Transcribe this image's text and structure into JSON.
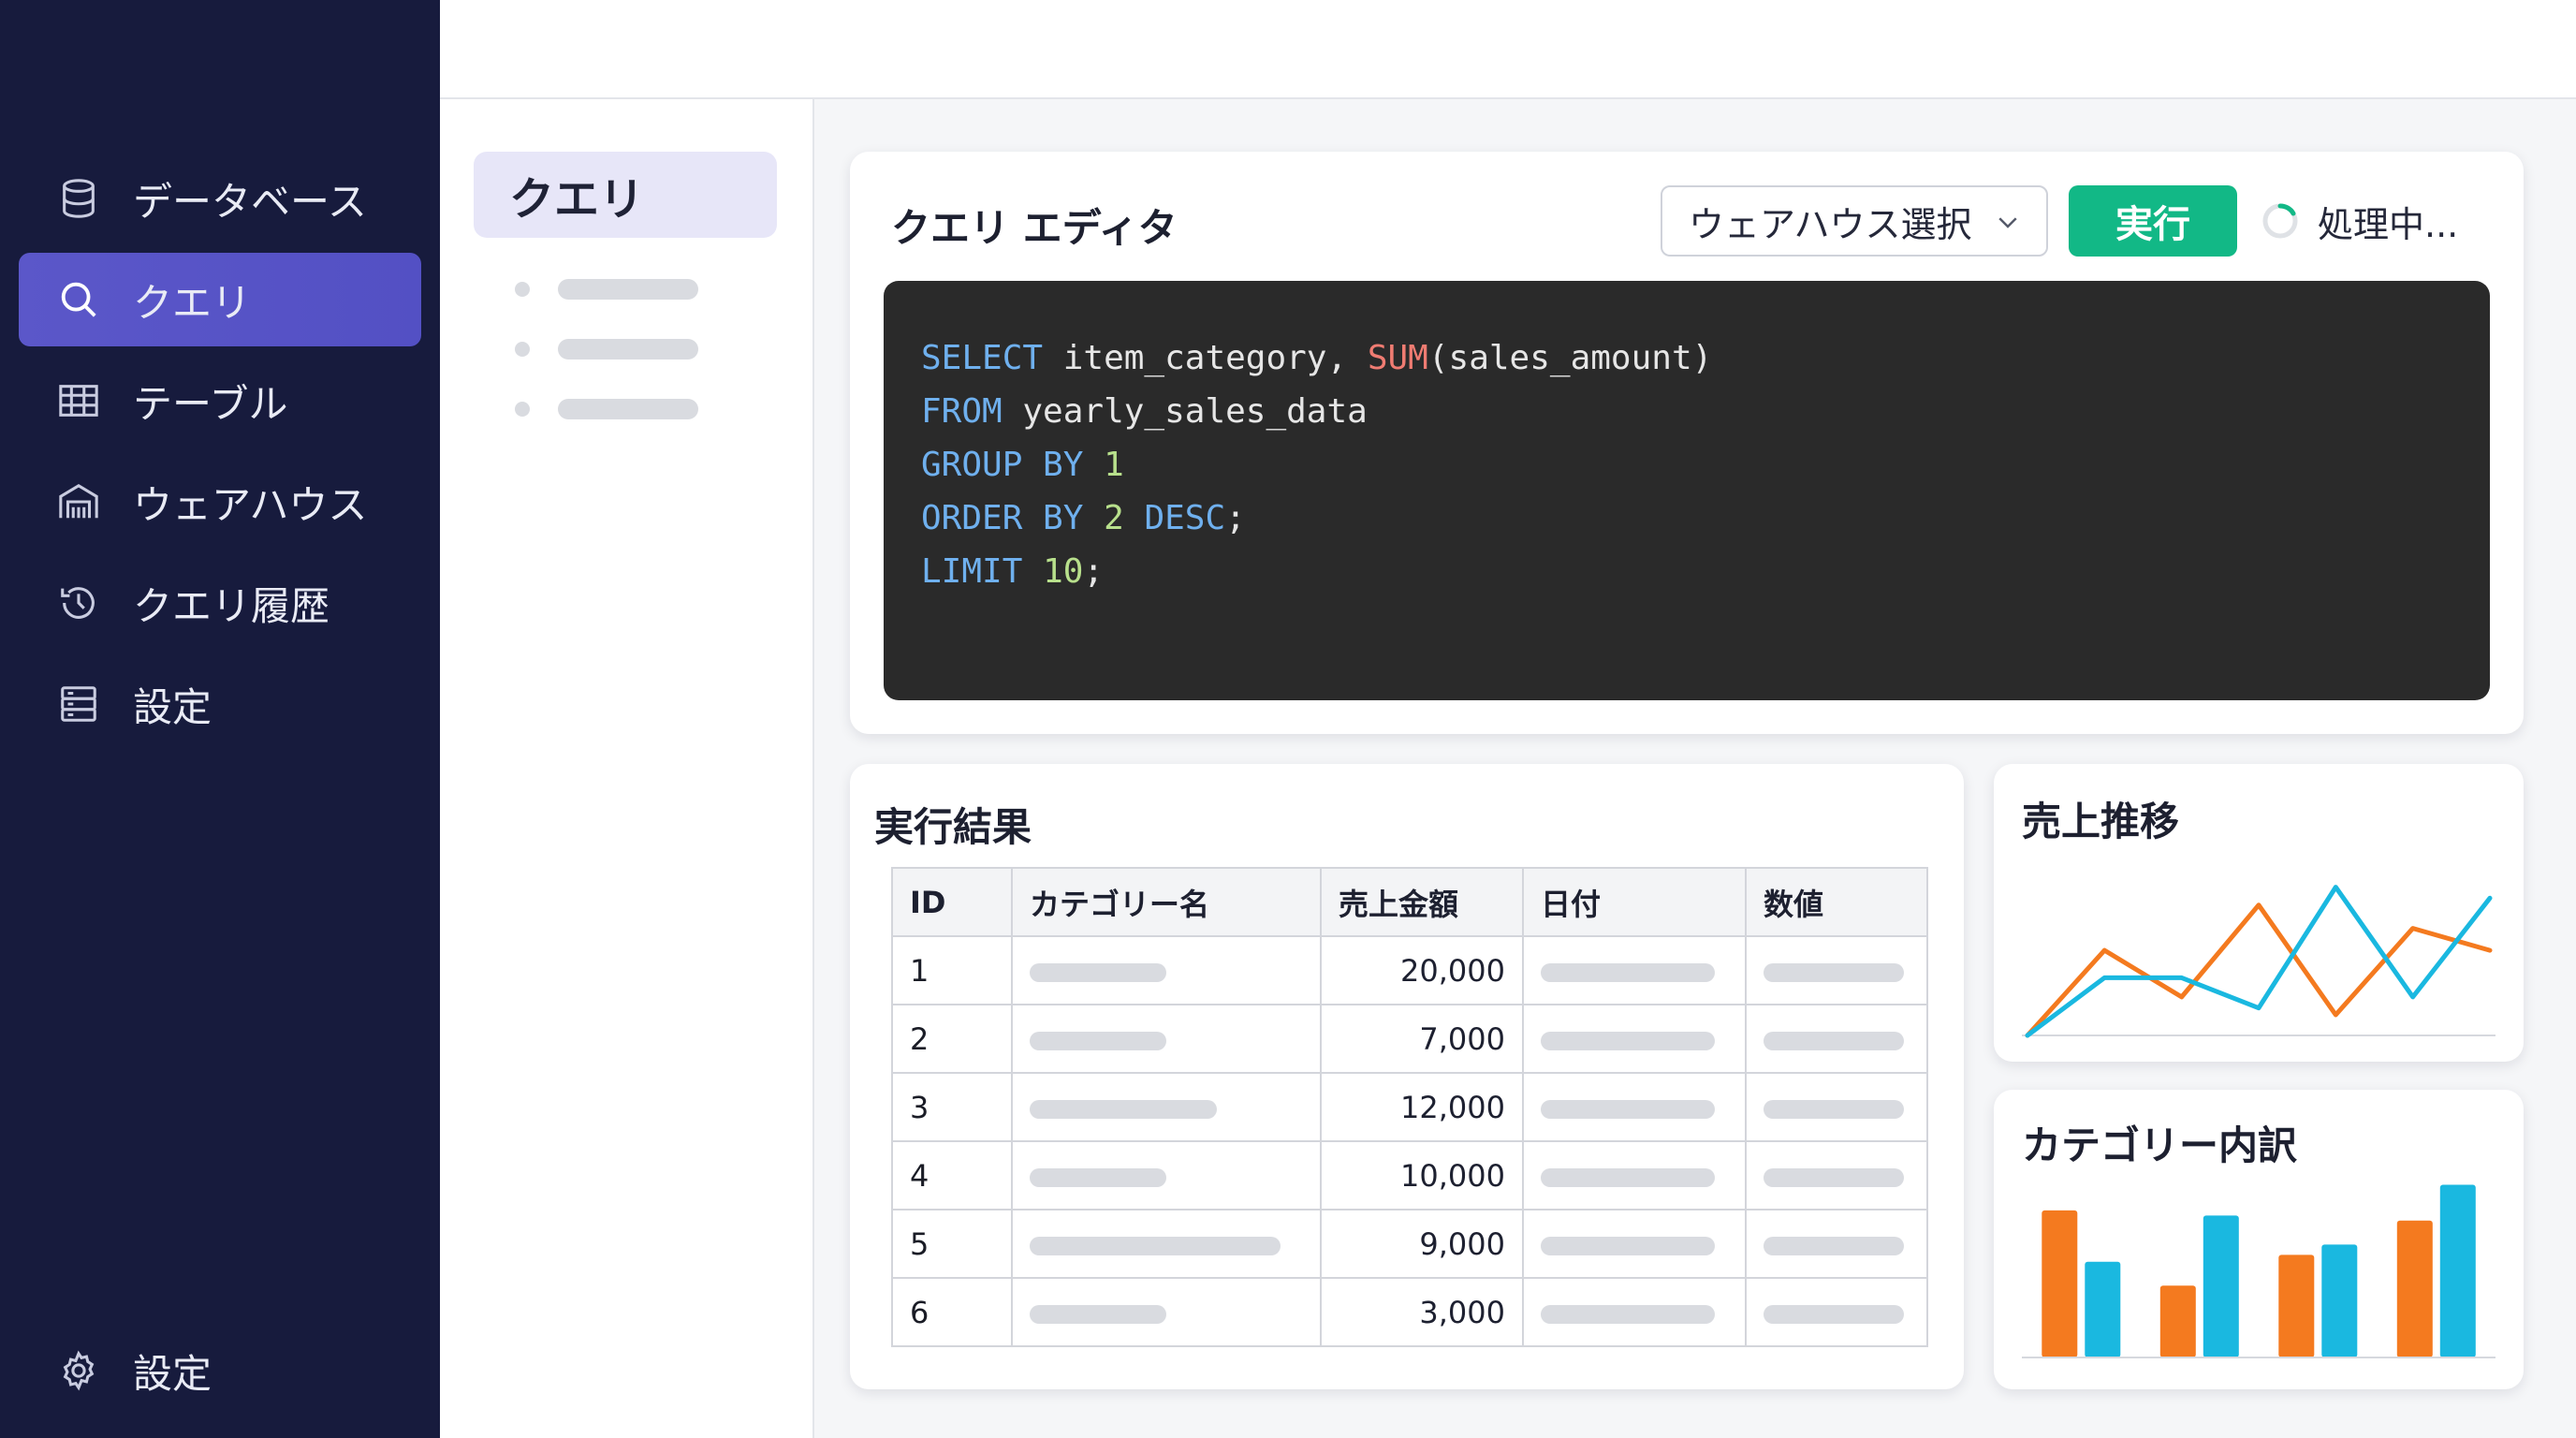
{
  "sidebar": {
    "items": [
      {
        "label": "データベース",
        "icon": "database-icon",
        "active": false
      },
      {
        "label": "クエリ",
        "icon": "search-icon",
        "active": true
      },
      {
        "label": "テーブル",
        "icon": "table-icon",
        "active": false
      },
      {
        "label": "ウェアハウス",
        "icon": "warehouse-icon",
        "active": false
      },
      {
        "label": "クエリ履歴",
        "icon": "history-icon",
        "active": false
      },
      {
        "label": "設定",
        "icon": "server-settings-icon",
        "active": false
      }
    ],
    "footer": {
      "label": "設定",
      "icon": "gear-icon"
    }
  },
  "subpanel": {
    "title": "クエリ"
  },
  "editor": {
    "title": "クエリ エディタ",
    "warehouse_select": "ウェアハウス選択",
    "run_label": "実行",
    "status": "処理中..."
  },
  "results": {
    "title": "実行結果",
    "columns": [
      "ID",
      "カテゴリー名",
      "売上金額",
      "日付",
      "数値"
    ],
    "rows": [
      {
        "id": "1",
        "amount": "20,000"
      },
      {
        "id": "2",
        "amount": "7,000"
      },
      {
        "id": "3",
        "amount": "12,000"
      },
      {
        "id": "4",
        "amount": "10,000"
      },
      {
        "id": "5",
        "amount": "9,000"
      },
      {
        "id": "6",
        "amount": "3,000"
      }
    ]
  },
  "trend_card": {
    "title": "売上推移"
  },
  "category_card": {
    "title": "カテゴリー内訳"
  },
  "colors": {
    "accent": "#5b57c9",
    "run": "#12b886",
    "orange": "#f47a1f",
    "cyan": "#1ab8e0"
  },
  "chart_data": [
    {
      "type": "line",
      "title": "売上推移",
      "series": [
        {
          "values": [
            0,
            62,
            28,
            95,
            15,
            78,
            62
          ]
        },
        {
          "values": [
            0,
            42,
            42,
            20,
            108,
            28,
            100
          ]
        }
      ]
    },
    {
      "type": "bar",
      "title": "カテゴリー内訳",
      "series": [
        {
          "values": [
            86,
            42,
            60,
            80
          ]
        },
        {
          "values": [
            56,
            83,
            66,
            101
          ]
        }
      ]
    }
  ]
}
